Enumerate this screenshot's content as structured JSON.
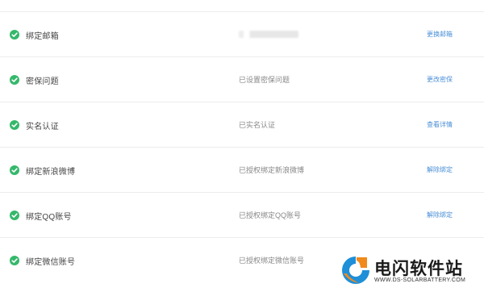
{
  "rows": [
    {
      "label": "绑定邮箱",
      "status": "",
      "action": "更换邮箱",
      "masked": true
    },
    {
      "label": "密保问题",
      "status": "已设置密保问题",
      "action": "更改密保"
    },
    {
      "label": "实名认证",
      "status": "已实名认证",
      "action": "查看详情"
    },
    {
      "label": "绑定新浪微博",
      "status": "已授权绑定新浪微博",
      "action": "解除绑定"
    },
    {
      "label": "绑定QQ账号",
      "status": "已授权绑定QQ账号",
      "action": "解除绑定"
    },
    {
      "label": "绑定微信账号",
      "status": "已授权绑定微信账号",
      "action": ""
    }
  ],
  "watermark": {
    "title": "电闪软件站",
    "url": "WWW.DS-SOLARBATTERY.COM"
  },
  "colors": {
    "check": "#35b86b",
    "link": "#4a8fd6",
    "divider": "#ececec"
  },
  "icons": {
    "status": "check-circle-icon",
    "watermark": "logo-icon"
  }
}
